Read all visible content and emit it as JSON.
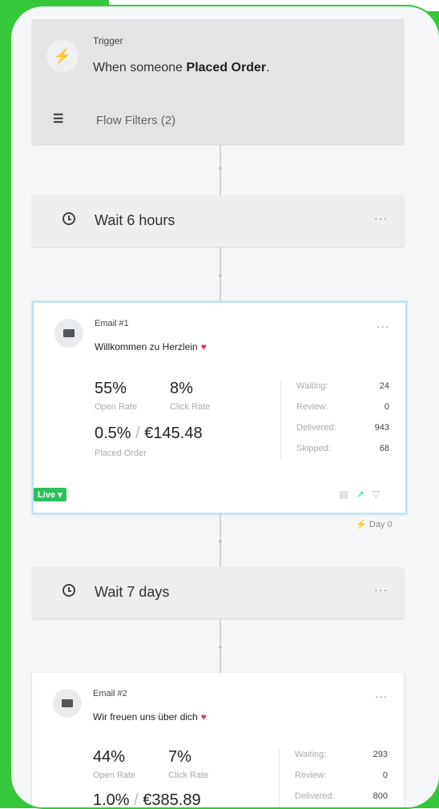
{
  "trigger": {
    "label": "Trigger",
    "text_prefix": "When someone",
    "text_bold": "Placed Order",
    "text_suffix": ".",
    "filters": "Flow Filters (2)",
    "icon": "lightning-icon"
  },
  "wait1": {
    "text": "Wait 6 hours",
    "more": "···"
  },
  "email1": {
    "label": "Email #1",
    "subject": "Willkommen zu Herzlein",
    "heart": "♥",
    "more": "···",
    "open_rate": "55%",
    "open_rate_label": "Open Rate",
    "click_rate": "8%",
    "click_rate_label": "Click Rate",
    "placed_pct": "0.5%",
    "placed_sep": "/",
    "placed_value": "€145.48",
    "placed_label": "Placed Order",
    "waiting_label": "Waiting:",
    "waiting": "24",
    "review_label": "Review:",
    "review": "0",
    "delivered_label": "Delivered:",
    "delivered": "943",
    "skipped_label": "Skipped:",
    "skipped": "68",
    "status": "Live ▾"
  },
  "day_label": "⚡ Day 0",
  "wait2": {
    "text": "Wait 7 days",
    "more": "···"
  },
  "email2": {
    "label": "Email #2",
    "subject": "Wir freuen uns über dich",
    "heart": "♥",
    "more": "···",
    "open_rate": "44%",
    "open_rate_label": "Open Rate",
    "click_rate": "7%",
    "click_rate_label": "Click Rate",
    "placed_pct": "1.0%",
    "placed_sep": "/",
    "placed_value": "€385.89",
    "waiting_label": "Waiting:",
    "waiting": "293",
    "review_label": "Review:",
    "review": "0",
    "delivered_label": "Delivered:",
    "delivered": "800"
  },
  "colors": {
    "frame_green": "#35c83a",
    "live_green": "#2cc15a",
    "heart_pink": "#e0307a",
    "selected_border": "#bde2f0"
  }
}
